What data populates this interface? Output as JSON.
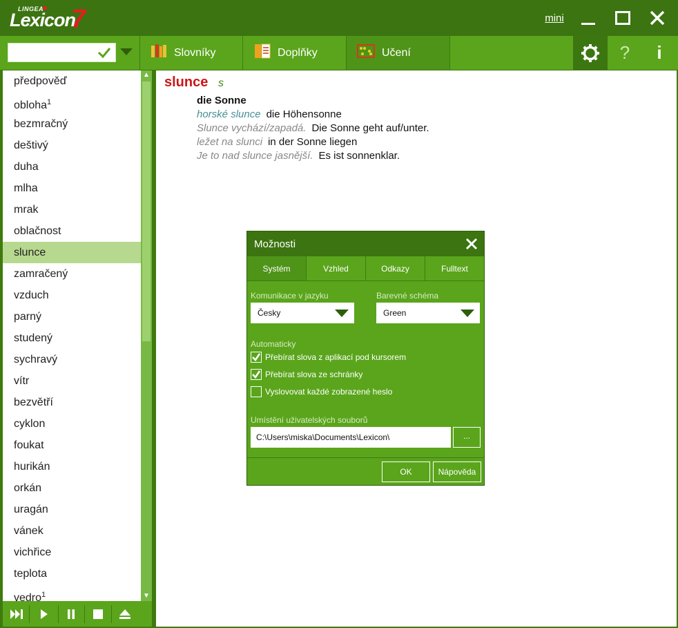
{
  "app": {
    "logo_brand": "LINGEA",
    "logo_name": "Lexicon",
    "logo_version": "7",
    "mini_label": "mini"
  },
  "toolbar": {
    "search_value": "",
    "tabs": [
      "Slovníky",
      "Doplňky",
      "Učení"
    ],
    "help_label": "?",
    "info_label": "i"
  },
  "wordlist": {
    "items": [
      {
        "text": "předpověď",
        "sup": ""
      },
      {
        "text": "obloha",
        "sup": "1"
      },
      {
        "text": "bezmračný",
        "sup": ""
      },
      {
        "text": "deštivý",
        "sup": ""
      },
      {
        "text": "duha",
        "sup": ""
      },
      {
        "text": "mlha",
        "sup": ""
      },
      {
        "text": "mrak",
        "sup": ""
      },
      {
        "text": "oblačnost",
        "sup": ""
      },
      {
        "text": "slunce",
        "sup": ""
      },
      {
        "text": "zamračený",
        "sup": ""
      },
      {
        "text": "vzduch",
        "sup": ""
      },
      {
        "text": "parný",
        "sup": ""
      },
      {
        "text": "studený",
        "sup": ""
      },
      {
        "text": "sychravý",
        "sup": ""
      },
      {
        "text": "vítr",
        "sup": ""
      },
      {
        "text": "bezvětří",
        "sup": ""
      },
      {
        "text": "cyklon",
        "sup": ""
      },
      {
        "text": "foukat",
        "sup": ""
      },
      {
        "text": "hurikán",
        "sup": ""
      },
      {
        "text": "orkán",
        "sup": ""
      },
      {
        "text": "uragán",
        "sup": ""
      },
      {
        "text": "vánek",
        "sup": ""
      },
      {
        "text": "vichřice",
        "sup": ""
      },
      {
        "text": "teplota",
        "sup": ""
      },
      {
        "text": "vedro",
        "sup": "1"
      }
    ],
    "selected_index": 8
  },
  "entry": {
    "headword": "slunce",
    "pos": "s",
    "translation": "die Sonne",
    "examples": [
      {
        "cz": "horské slunce",
        "de": "die Höhensonne",
        "link": true
      },
      {
        "cz": "Slunce vychází/zapadá.",
        "de": "Die Sonne geht auf/unter.",
        "link": false
      },
      {
        "cz": "ležet na slunci",
        "de": "in der Sonne liegen",
        "link": false
      },
      {
        "cz": "Je to nad slunce jasnější.",
        "de": "Es ist sonnenklar.",
        "link": false
      }
    ]
  },
  "dialog": {
    "title": "Možnosti",
    "tabs": [
      "Systém",
      "Vzhled",
      "Odkazy",
      "Fulltext"
    ],
    "active_tab": 0,
    "language_label": "Komunikace v jazyku",
    "language_value": "Česky",
    "scheme_label": "Barevné schéma",
    "scheme_value": "Green",
    "auto_label": "Automaticky",
    "checkboxes": [
      {
        "label": "Přebírat slova z aplikací pod kursorem",
        "checked": true
      },
      {
        "label": "Přebírat slova ze schránky",
        "checked": true
      },
      {
        "label": "Vyslovovat každé zobrazené heslo",
        "checked": false
      }
    ],
    "path_label": "Umístění uživatelských souborů",
    "path_value": "C:\\Users\\miska\\Documents\\Lexicon\\",
    "browse_label": "...",
    "ok_label": "OK",
    "help_label": "Nápověda"
  },
  "colors": {
    "accent": "#5aa51c",
    "dark": "#3b7410",
    "headword": "#cc1616",
    "selected_row": "#b7d88f"
  }
}
